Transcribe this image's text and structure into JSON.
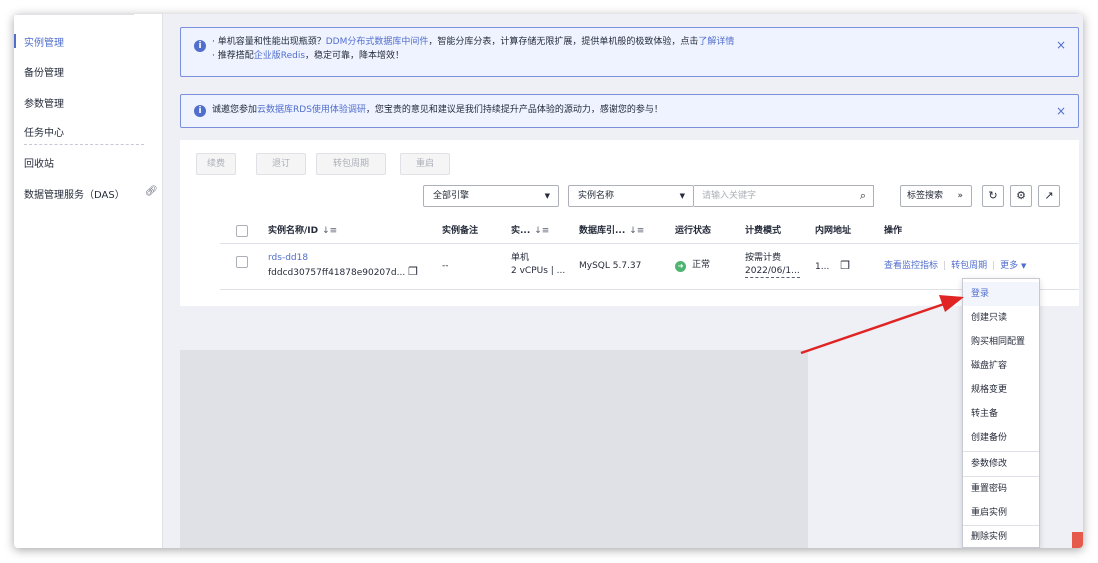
{
  "sidebar": {
    "items": [
      {
        "label": "实例管理",
        "active": true
      },
      {
        "label": "备份管理"
      },
      {
        "label": "参数管理"
      },
      {
        "label": "任务中心"
      },
      {
        "label": "回收站"
      },
      {
        "label": "数据管理服务（DAS）"
      }
    ]
  },
  "notices": [
    {
      "line1": {
        "prefix": "· 单机容量和性能出现瓶颈？",
        "link1": "DDM分布式数据库中间件",
        "middle": "，智能分库分表，计算存储无限扩展，提供单机般的极致体验，点击",
        "link2": "了解详情"
      },
      "line2": {
        "prefix": "· 推荐搭配",
        "link": "企业版Redis",
        "suffix": "，稳定可靠，降本增效！"
      },
      "close": "×"
    },
    {
      "prefix": "诚邀您参加",
      "link": "云数据库RDS使用体验调研",
      "suffix": "，您宝贵的意见和建议是我们持续提升产品体验的源动力，感谢您的参与！",
      "close": "×"
    }
  ],
  "toolbar": {
    "buttons": [
      "续费",
      "退订",
      "转包周期",
      "重启"
    ],
    "engine_select": "全部引擎",
    "field_select": "实例名称",
    "search_placeholder": "请输入关键字",
    "tag_search": "标签搜索"
  },
  "table": {
    "headers": [
      "实例名称/ID",
      "实例备注",
      "实...",
      "数据库引...",
      "运行状态",
      "计费模式",
      "内网地址",
      "操作"
    ],
    "row": {
      "name": "rds-dd18",
      "id": "fddcd30757ff41878e90207d...",
      "remark": "--",
      "type_line1": "单机",
      "type_line2": "2 vCPUs | ...",
      "engine": "MySQL 5.7.37",
      "status": "正常",
      "billing_line1": "按需计费",
      "billing_line2": "2022/06/1...",
      "ip": "1...",
      "ops": [
        "查看监控指标",
        "转包周期",
        "更多"
      ]
    }
  },
  "more_menu": [
    "登录",
    "创建只读",
    "购买相同配置",
    "磁盘扩容",
    "规格变更",
    "转主备",
    "创建备份",
    "参数修改",
    "重置密码",
    "重启实例",
    "删除实例"
  ],
  "colors": {
    "accent": "#526ecc",
    "status_ok": "#50b371",
    "annotation_arrow": "#e02424"
  }
}
